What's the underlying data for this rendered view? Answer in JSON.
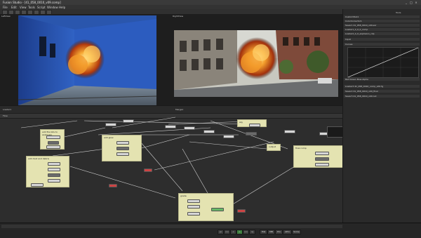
{
  "window": {
    "title": "Fusion Studio - [41_058_0010_v09.comp]",
    "controls": [
      "_",
      "□",
      "×"
    ]
  },
  "menu": [
    "File",
    "Edit",
    "View",
    "Tools",
    "Script",
    "Window",
    "Help"
  ],
  "viewer": {
    "left_label": "LeftView",
    "right_label": "RightView",
    "left_footer": "Loader1",
    "right_footer": "Merge1"
  },
  "flow": {
    "header": "Flow",
    "notes": [
      {
        "title": "add fire bits to explosion"
      },
      {
        "title": "add dust and debris"
      },
      {
        "title": "add glow"
      },
      {
        "title": "sky"
      },
      {
        "title": "final comp"
      },
      {
        "title": "grade"
      },
      {
        "title": "output"
      }
    ]
  },
  "inspector": {
    "tab": "Tools",
    "rows": [
      "CustomTool1",
      "ColorCorrector1",
      "Saver1 41_058_0010_v09.exr",
      "Loader1_0_0_0_comp",
      "Loader2_0_0_explosion_clip",
      "Input",
      "Curves",
      "Red  Green  Blue  Alpha",
      "Loader3 41_058_0010_comp_v09 fg",
      "Saver2 41_058_0010_v09_final",
      "Saver3 41_058_0010_v09 out"
    ]
  },
  "timeline": {
    "buttons": [
      "|<",
      "<<",
      "<",
      ">",
      ">>",
      ">|",
      "HiQ",
      "MB",
      "Prx",
      "APrx",
      "Some"
    ]
  },
  "colors": {
    "note_bg": "#e4e3b1",
    "wall_blue": "#2c4fa8",
    "fire_orange": "#f29a2a",
    "panel_bg": "#2a2a2a"
  }
}
